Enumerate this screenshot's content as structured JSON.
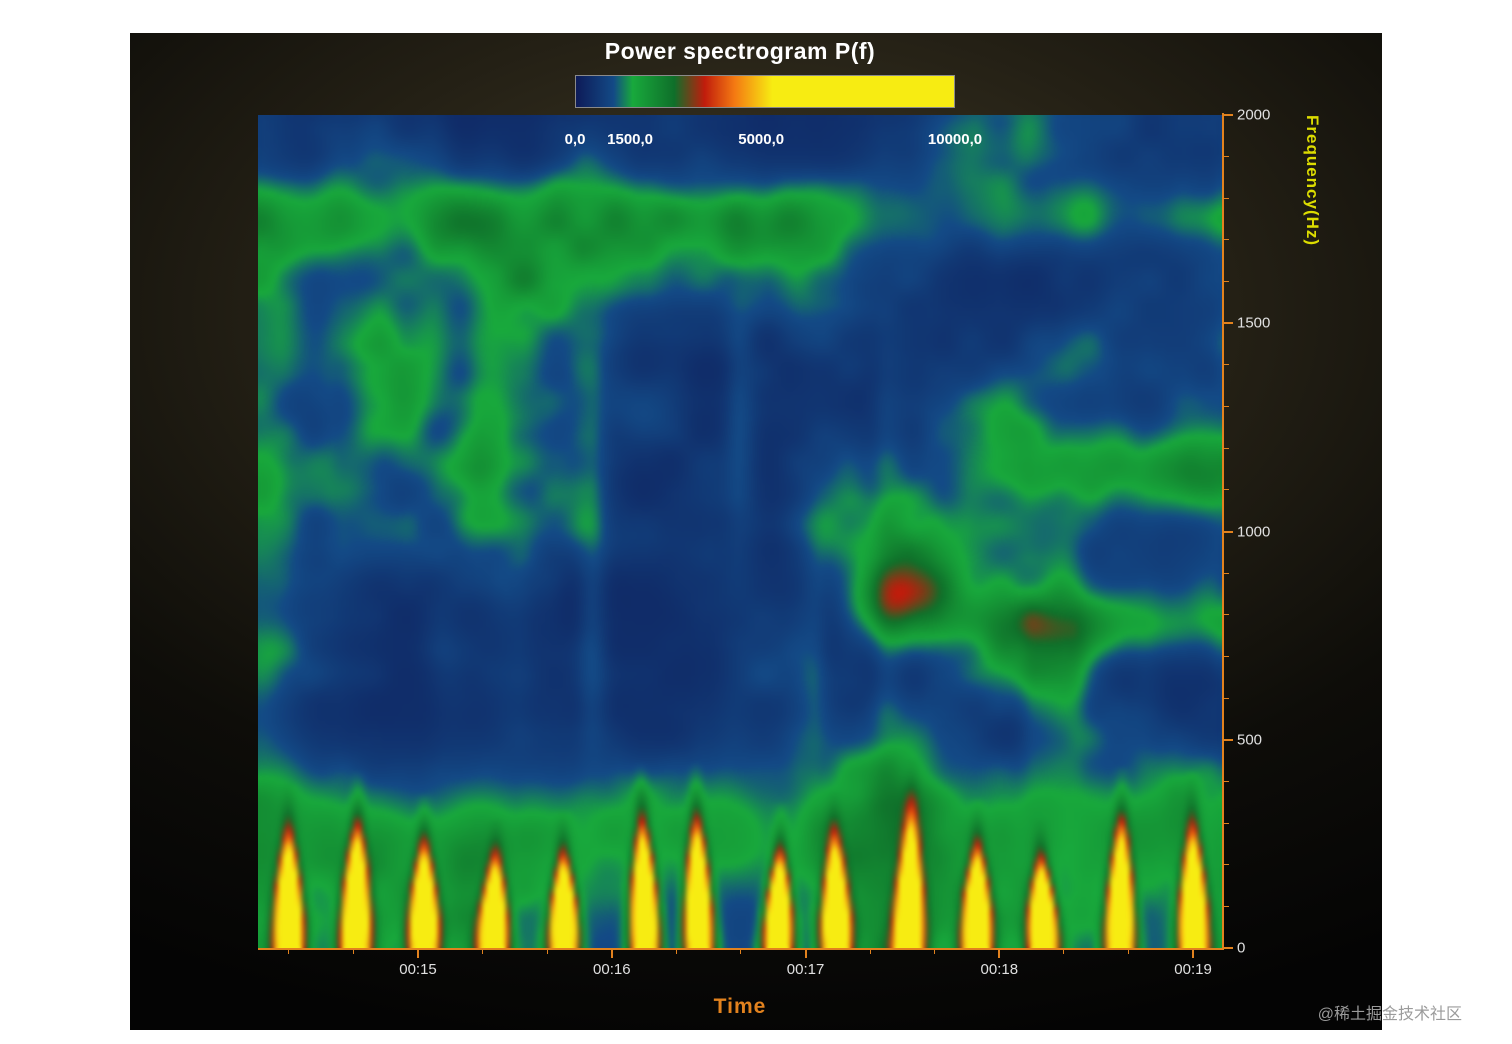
{
  "page": {
    "watermark": "@稀土掘金技术社区"
  },
  "chart_data": {
    "type": "heatmap",
    "title": "Power spectrogram P(f)",
    "xlabel": "Time",
    "ylabel": "Frequency(Hz)",
    "x_axis": {
      "ticks": [
        {
          "label": "00:15",
          "pos": 0.166
        },
        {
          "label": "00:16",
          "pos": 0.367
        },
        {
          "label": "00:17",
          "pos": 0.568
        },
        {
          "label": "00:18",
          "pos": 0.769
        },
        {
          "label": "00:19",
          "pos": 0.97
        }
      ],
      "minor_step": 0.067
    },
    "y_axis": {
      "min": 0,
      "max": 2000,
      "ticks": [
        {
          "label": "0",
          "value": 0
        },
        {
          "label": "500",
          "value": 500
        },
        {
          "label": "1000",
          "value": 1000
        },
        {
          "label": "1500",
          "value": 1500
        },
        {
          "label": "2000",
          "value": 2000
        }
      ],
      "minor_step_value": 100
    },
    "colorbar": {
      "value_range": [
        0,
        10000
      ],
      "tick_labels": [
        {
          "label": "0,0",
          "pos": 0.0
        },
        {
          "label": "1500,0",
          "pos": 0.145
        },
        {
          "label": "5000,0",
          "pos": 0.49
        },
        {
          "label": "10000,0",
          "pos": 1.0
        }
      ],
      "stops": [
        {
          "value": 0,
          "color": "#0e1b58"
        },
        {
          "value": 1000,
          "color": "#134a86"
        },
        {
          "value": 1500,
          "color": "#18a93c"
        },
        {
          "value": 2600,
          "color": "#0f6f2a"
        },
        {
          "value": 3400,
          "color": "#c01c0c"
        },
        {
          "value": 4200,
          "color": "#f47a12"
        },
        {
          "value": 5200,
          "color": "#f7ec12"
        },
        {
          "value": 10000,
          "color": "#f7ec12"
        }
      ]
    },
    "colors": {
      "axis": "#e2821e",
      "tick_label": "#e0e0e0",
      "title": "#ffffff",
      "ylabel": "#dcdc00",
      "xlabel": "#e2821e"
    },
    "spectrogram": {
      "flame_count": 14,
      "bands": [
        {
          "fy": 0.88,
          "sigma": 0.045,
          "amp": 900,
          "right_only": false
        },
        {
          "fy": 0.14,
          "sigma": 0.075,
          "amp": 1200,
          "right_only": false
        },
        {
          "fy": 0.575,
          "sigma": 0.045,
          "amp": 1500,
          "right_only": true
        },
        {
          "fy": 0.385,
          "sigma": 0.04,
          "amp": 1300,
          "right_only": true
        }
      ],
      "hotspot": {
        "u": 0.67,
        "fy": 0.42,
        "amp": 2600
      }
    }
  }
}
